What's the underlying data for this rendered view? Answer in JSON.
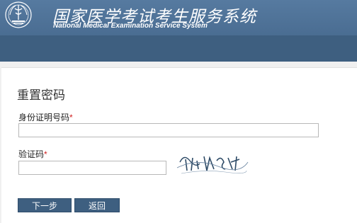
{
  "header": {
    "logo_icon": "emblem-icon",
    "title_cn": "国家医学考试考生服务系统",
    "title_en": "National Medical Examination Service System"
  },
  "form": {
    "title": "重置密码",
    "id_label": "身份证明号码",
    "id_value": "",
    "captcha_label": "验证码",
    "captcha_value": "",
    "required_mark": "*"
  },
  "buttons": {
    "next": "下一步",
    "back": "返回"
  },
  "colors": {
    "header": "#4a6d92",
    "navbar": "#3e5f80",
    "button": "#3e5f80",
    "required": "#d02020"
  }
}
